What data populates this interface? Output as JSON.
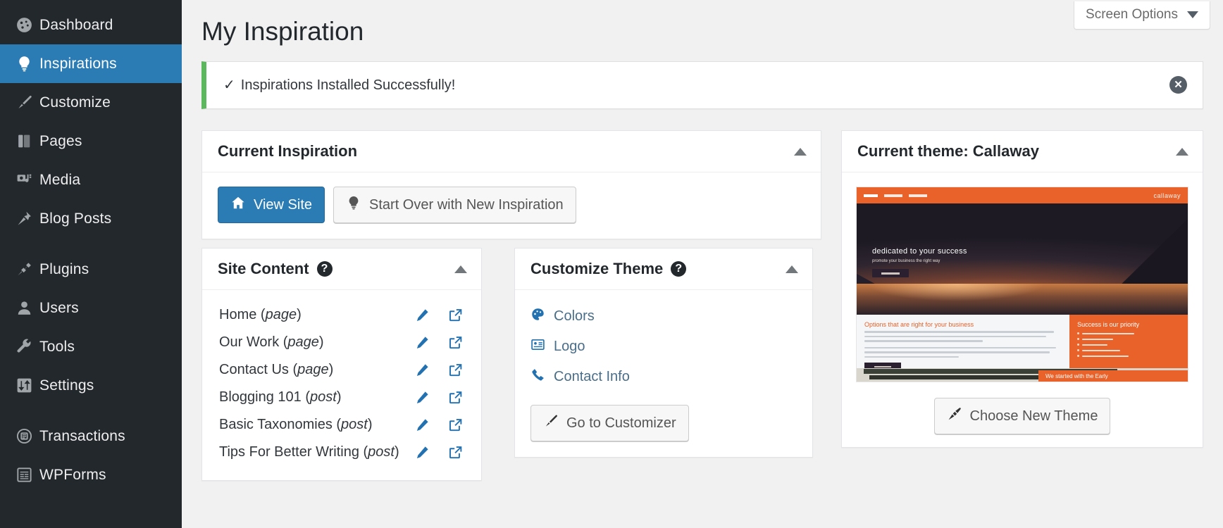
{
  "sidebar": {
    "items": [
      {
        "label": "Dashboard",
        "icon": "dashboard-icon",
        "current": false
      },
      {
        "label": "Inspirations",
        "icon": "lightbulb-icon",
        "current": true
      },
      {
        "label": "Customize",
        "icon": "paintbrush-icon",
        "current": false
      },
      {
        "label": "Pages",
        "icon": "pages-icon",
        "current": false
      },
      {
        "label": "Media",
        "icon": "media-icon",
        "current": false
      },
      {
        "label": "Blog Posts",
        "icon": "pushpin-icon",
        "current": false
      },
      {
        "label": "Plugins",
        "icon": "plug-icon",
        "current": false
      },
      {
        "label": "Users",
        "icon": "user-icon",
        "current": false
      },
      {
        "label": "Tools",
        "icon": "wrench-icon",
        "current": false
      },
      {
        "label": "Settings",
        "icon": "sliders-icon",
        "current": false
      },
      {
        "label": "Transactions",
        "icon": "transactions-icon",
        "current": false
      },
      {
        "label": "WPForms",
        "icon": "wpforms-icon",
        "current": false
      }
    ]
  },
  "header": {
    "page_title": "My Inspiration",
    "screen_options_label": "Screen Options"
  },
  "notice": {
    "check": "✓",
    "message": "Inspirations Installed Successfully!",
    "accent_color": "#5cb85c",
    "dismiss_label": "✕"
  },
  "current_inspiration": {
    "title": "Current Inspiration",
    "view_site_label": "View Site",
    "start_over_label": "Start Over with New Inspiration"
  },
  "site_content": {
    "title": "Site Content",
    "help_glyph": "?",
    "rows": [
      {
        "name": "Home",
        "type": "page"
      },
      {
        "name": "Our Work",
        "type": "page"
      },
      {
        "name": "Contact Us",
        "type": "page"
      },
      {
        "name": "Blogging 101",
        "type": "post"
      },
      {
        "name": "Basic Taxonomies",
        "type": "post"
      },
      {
        "name": "Tips For Better Writing",
        "type": "post"
      }
    ]
  },
  "customize_theme": {
    "title": "Customize Theme",
    "help_glyph": "?",
    "links": [
      {
        "label": "Colors",
        "icon": "color-palette-icon"
      },
      {
        "label": "Logo",
        "icon": "image-card-icon"
      },
      {
        "label": "Contact Info",
        "icon": "phone-icon"
      }
    ],
    "customizer_button_label": "Go to Customizer"
  },
  "current_theme": {
    "title": "Current theme: Callaway",
    "theme_name": "Callaway",
    "choose_new_theme_label": "Choose New Theme",
    "preview": {
      "brand": "callaway",
      "hero_heading": "dedicated to your success",
      "hero_subheading": "promote your business the right way",
      "left_heading": "Options that are right for your business",
      "right_heading": "Success is our priority",
      "footer_tag": "We started with the Early"
    }
  },
  "colors": {
    "admin_menu_bg": "#23282d",
    "accent_blue": "#2b7cb4",
    "link_blue": "#2271b1",
    "theme_orange": "#e8622a",
    "success_green": "#5cb85c"
  }
}
